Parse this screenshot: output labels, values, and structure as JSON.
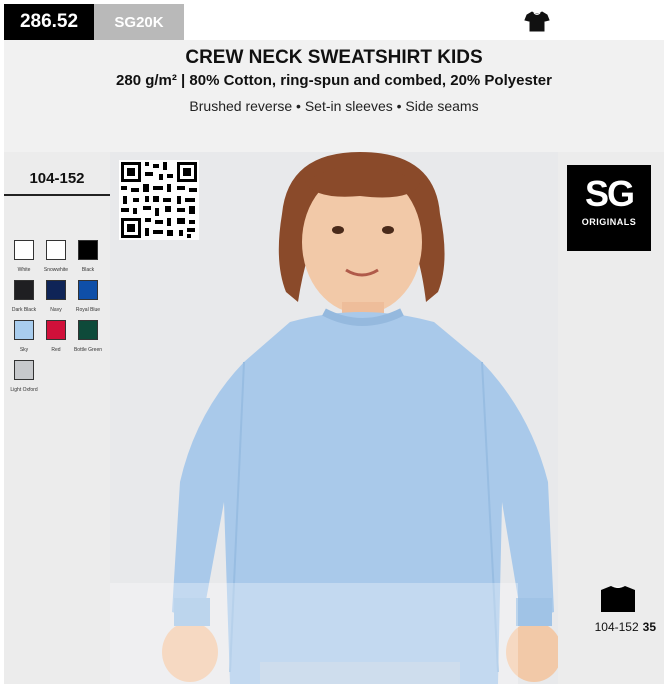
{
  "header": {
    "article_number": "286.52",
    "product_code": "SG20K",
    "title": "CREW NECK SWEATSHIRT KIDS",
    "composition": "280 g/m² | 80% Cotton, ring-spun and combed, 20% Polyester",
    "features": "Brushed reverse • Set-in sleeves • Side seams"
  },
  "sizes": {
    "range": "104-152"
  },
  "colors": [
    {
      "name": "White",
      "hex": "#ffffff"
    },
    {
      "name": "Snowwhite",
      "hex": "#ffffff"
    },
    {
      "name": "Black",
      "hex": "#000000"
    },
    {
      "name": "Dark Black",
      "hex": "#1f1f22"
    },
    {
      "name": "Navy",
      "hex": "#0f2457"
    },
    {
      "name": "Royal Blue",
      "hex": "#0f4fa8"
    },
    {
      "name": "Sky",
      "hex": "#a9cdee"
    },
    {
      "name": "Red",
      "hex": "#d0103a"
    },
    {
      "name": "Bottle Green",
      "hex": "#0e4a3a"
    },
    {
      "name": "Light Oxford",
      "hex": "#c7c9cc"
    }
  ],
  "brand": {
    "logo_text": "SG",
    "logo_subtext": "ORIGINALS"
  },
  "footer": {
    "size_range": "104-152",
    "page_number": "35"
  },
  "icons": [
    "t-shirt-icon",
    "qr-code",
    "kids-shirt-icon"
  ]
}
